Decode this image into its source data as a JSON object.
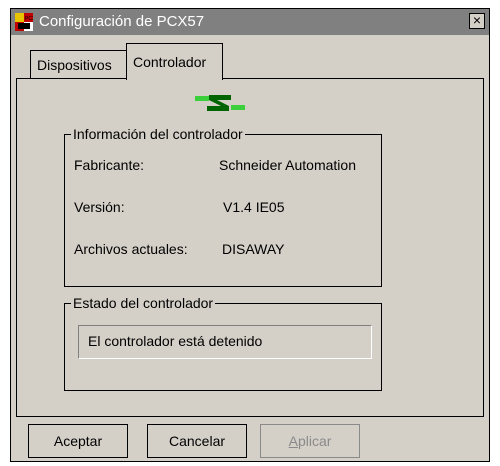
{
  "window": {
    "title": "Configuración de PCX57",
    "close_glyph": "×"
  },
  "tabs": [
    {
      "label": "Dispositivos",
      "active": false
    },
    {
      "label": "Controlador",
      "active": true
    }
  ],
  "logo": {
    "icon": "schneider-s-logo-icon",
    "colors": {
      "main": "#006400",
      "accent": "#3ccf3c"
    }
  },
  "controller_info": {
    "legend": "Información del controlador",
    "rows": [
      {
        "label": "Fabricante:",
        "value": "Schneider Automation"
      },
      {
        "label": "Versión:",
        "value": "V1.4 IE05"
      },
      {
        "label": "Archivos actuales:",
        "value": "DISAWAY"
      }
    ]
  },
  "controller_status": {
    "legend": "Estado del controlador",
    "text": "El controlador está detenido"
  },
  "buttons": {
    "accept": "Aceptar",
    "cancel": "Cancelar",
    "apply_accel": "A",
    "apply_rest": "plicar"
  },
  "colors": {
    "titlebar": "#808080",
    "face": "#d4d0c8",
    "disabled_text": "#8a8a8a"
  }
}
